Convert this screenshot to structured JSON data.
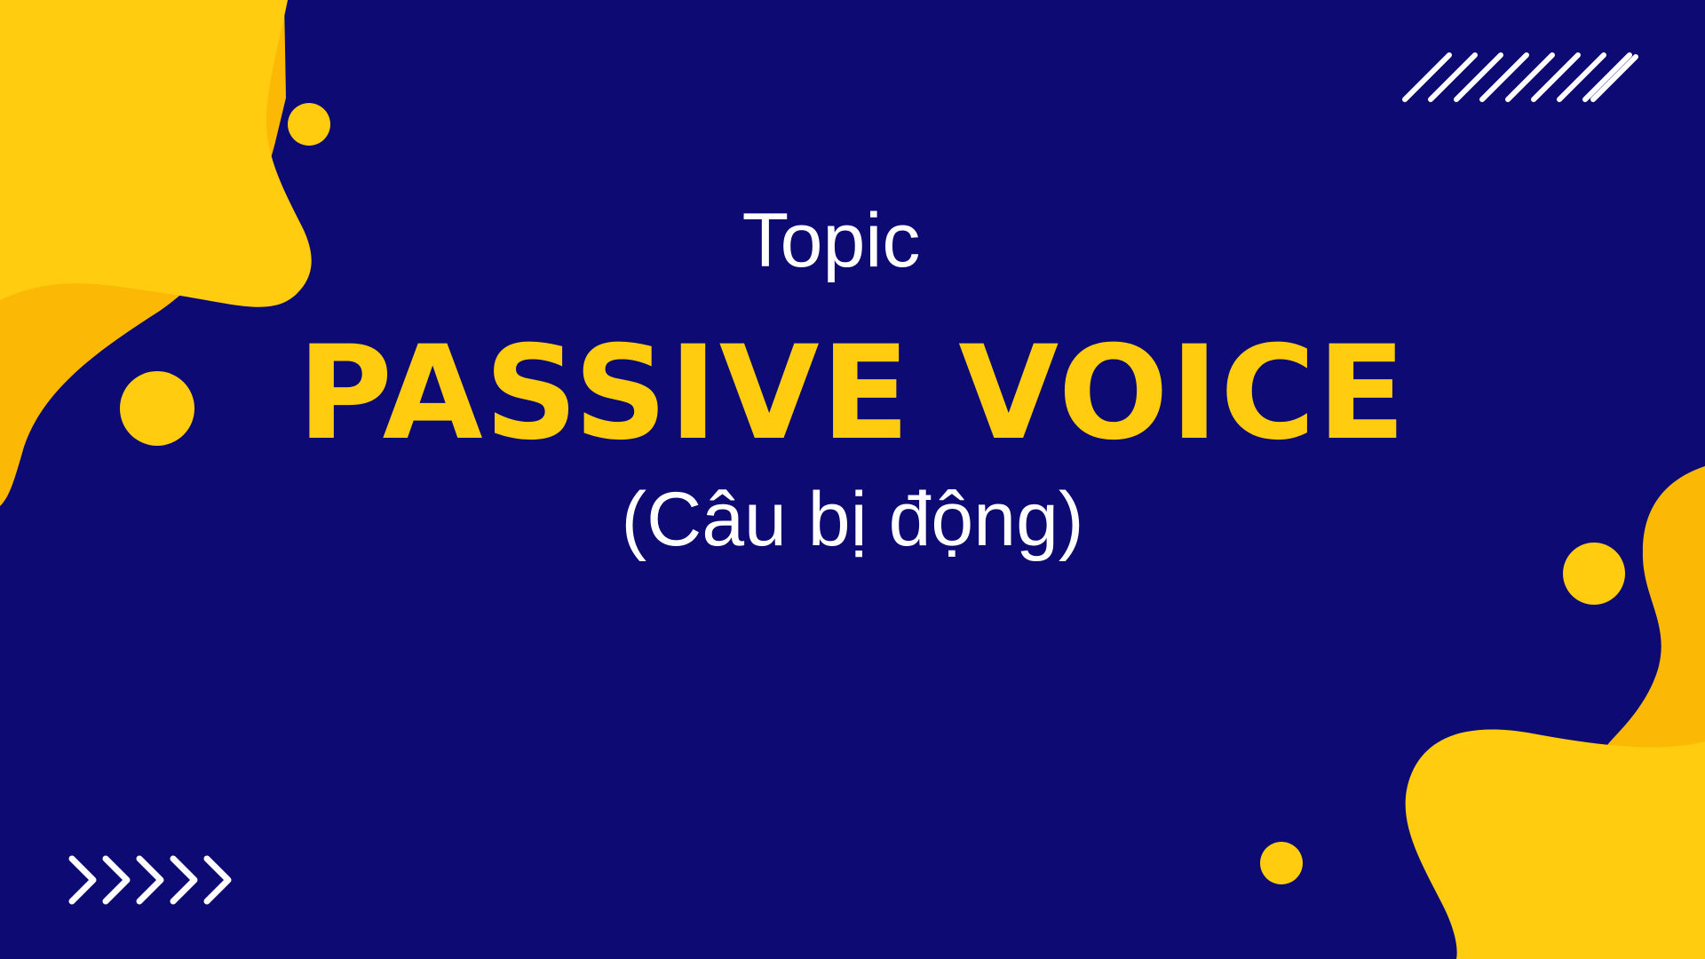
{
  "slide": {
    "topic_label": "Topic",
    "title": "PASSIVE VOICE",
    "subtitle": "(Câu bị động)"
  },
  "colors": {
    "background": "#0d0b73",
    "accent": "#ffcc0f",
    "accent_dark": "#fbb905",
    "text": "#ffffff"
  },
  "decorations": {
    "stripes_icon": "diagonal-stripes-icon",
    "chevrons_icon": "chevron-right-icon",
    "chevron_count": 5,
    "stripe_count": 9
  }
}
